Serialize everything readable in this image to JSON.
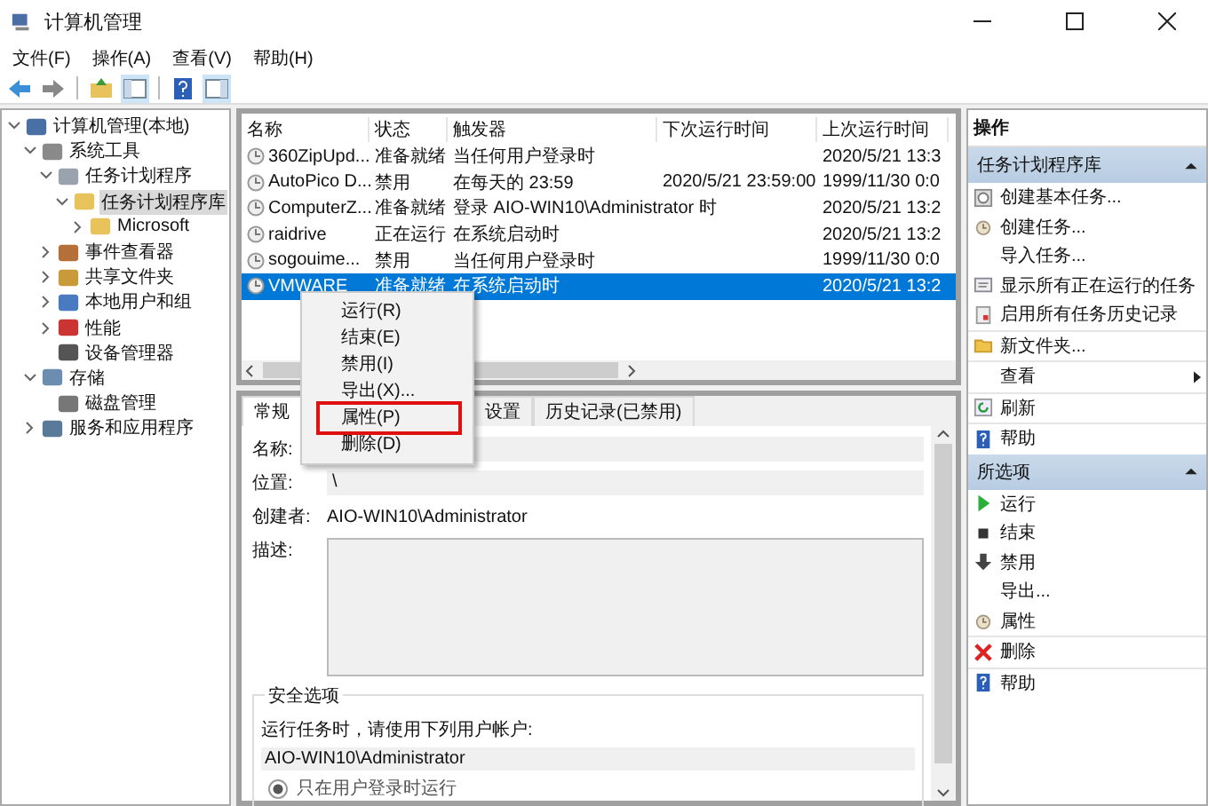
{
  "window": {
    "title": "计算机管理"
  },
  "menu": [
    "文件(F)",
    "操作(A)",
    "查看(V)",
    "帮助(H)"
  ],
  "tree": [
    {
      "label": "计算机管理(本地)",
      "expanded": true,
      "selected": false,
      "children": [
        {
          "label": "系统工具",
          "expanded": true,
          "selected": false,
          "children": [
            {
              "label": "任务计划程序",
              "expanded": true,
              "selected": false,
              "children": [
                {
                  "label": "任务计划程序库",
                  "expanded": true,
                  "selected": true,
                  "children": [
                    {
                      "label": "Microsoft",
                      "expanded": false,
                      "selected": false
                    }
                  ]
                }
              ]
            },
            {
              "label": "事件查看器",
              "expanded": false,
              "selected": false
            },
            {
              "label": "共享文件夹",
              "expanded": false,
              "selected": false
            },
            {
              "label": "本地用户和组",
              "expanded": false,
              "selected": false
            },
            {
              "label": "性能",
              "expanded": false,
              "selected": false
            },
            {
              "label": "设备管理器",
              "selected": false
            }
          ]
        },
        {
          "label": "存储",
          "expanded": true,
          "selected": false,
          "children": [
            {
              "label": "磁盘管理",
              "selected": false
            }
          ]
        },
        {
          "label": "服务和应用程序",
          "expanded": false,
          "selected": false
        }
      ]
    }
  ],
  "tasks": {
    "columns": [
      "名称",
      "状态",
      "触发器",
      "下次运行时间",
      "上次运行时间"
    ],
    "rows": [
      {
        "cells": [
          "360ZipUpd...",
          "准备就绪",
          "当任何用户登录时",
          "",
          "2020/5/21 13:3"
        ],
        "selected": false
      },
      {
        "cells": [
          "AutoPico D...",
          "禁用",
          "在每天的 23:59",
          "2020/5/21 23:59:00",
          "1999/11/30 0:0"
        ],
        "selected": false
      },
      {
        "cells": [
          "ComputerZ...",
          "准备就绪",
          "登录 AIO-WIN10\\Administrator 时",
          "",
          "2020/5/21 13:2"
        ],
        "selected": false
      },
      {
        "cells": [
          "raidrive",
          "正在运行",
          "在系统启动时",
          "",
          "2020/5/21 13:2"
        ],
        "selected": false
      },
      {
        "cells": [
          "sogouime...",
          "禁用",
          "当任何用户登录时",
          "",
          "1999/11/30 0:0"
        ],
        "selected": false
      },
      {
        "cells": [
          "VMWARE",
          "准备就绪",
          "在系统启动时",
          "",
          "2020/5/21 13:2"
        ],
        "selected": true
      }
    ]
  },
  "context_menu": [
    {
      "label": "运行(R)",
      "annotated": false
    },
    {
      "label": "结束(E)",
      "annotated": false
    },
    {
      "label": "禁用(I)",
      "annotated": false
    },
    {
      "label": "导出(X)...",
      "annotated": false
    },
    {
      "label": "属性(P)",
      "annotated": true
    },
    {
      "label": "删除(D)",
      "annotated": false
    }
  ],
  "details": {
    "tabs": [
      {
        "label": "常规",
        "selected": true
      },
      {
        "label": "设置",
        "selected": false
      },
      {
        "label": "历史记录(已禁用)",
        "selected": false
      }
    ],
    "fields": [
      {
        "label": "名称:",
        "kind": "field"
      },
      {
        "label": "位置:",
        "value": "\\",
        "kind": "field"
      },
      {
        "label": "创建者:",
        "value": "AIO-WIN10\\Administrator",
        "kind": "text"
      },
      {
        "label": "描述:",
        "kind": "area"
      }
    ],
    "security": {
      "title": "安全选项",
      "prompt": "运行任务时，请使用下列用户帐户:",
      "account": "AIO-WIN10\\Administrator",
      "options": [
        {
          "label": "只在用户登录时运行",
          "selected": true,
          "disabled": true
        }
      ]
    }
  },
  "actions": {
    "title": "操作",
    "sections": [
      {
        "title": "任务计划程序库",
        "items": [
          {
            "label": "创建基本任务...",
            "separator_before": false
          },
          {
            "label": "创建任务...",
            "separator_before": false
          },
          {
            "label": "导入任务...",
            "separator_before": false
          },
          {
            "label": "显示所有正在运行的任务",
            "separator_before": false
          },
          {
            "label": "启用所有任务历史记录",
            "separator_before": false
          },
          {
            "label": "新文件夹...",
            "separator_before": true
          },
          {
            "label": "查看",
            "separator_before": true,
            "submenu": true
          },
          {
            "label": "刷新",
            "separator_before": true
          },
          {
            "label": "帮助",
            "separator_before": true
          }
        ]
      },
      {
        "title": "所选项",
        "items": [
          {
            "label": "运行",
            "separator_before": false
          },
          {
            "label": "结束",
            "separator_before": false
          },
          {
            "label": "禁用",
            "separator_before": false
          },
          {
            "label": "导出...",
            "separator_before": false
          },
          {
            "label": "属性",
            "separator_before": false
          },
          {
            "label": "删除",
            "separator_before": true
          },
          {
            "label": "帮助",
            "separator_before": true
          }
        ]
      }
    ]
  }
}
